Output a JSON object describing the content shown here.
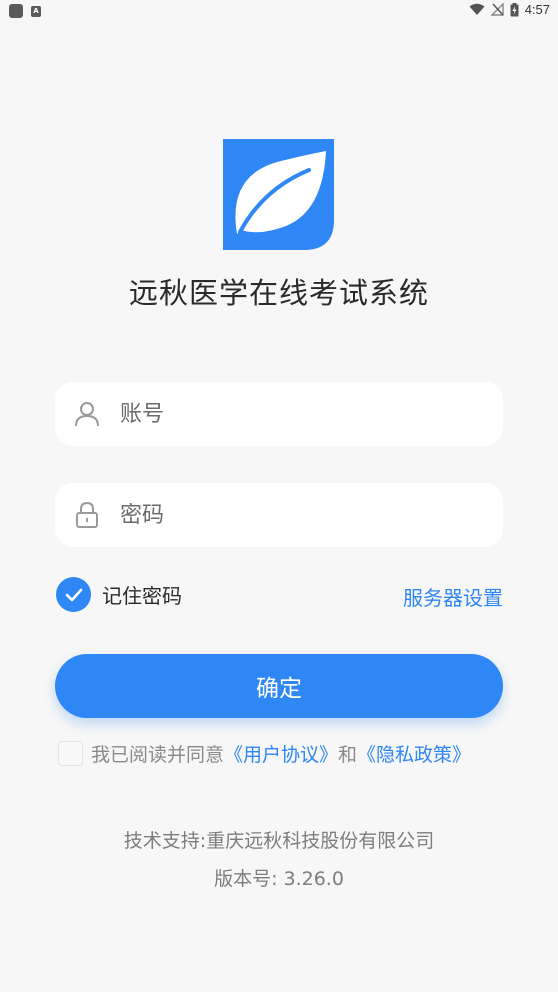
{
  "status_bar": {
    "time": "4:57",
    "icons": [
      "app-square-icon",
      "a-badge-icon",
      "wifi-icon",
      "no-signal-icon",
      "battery-charging-icon"
    ]
  },
  "app": {
    "title": "远秋医学在线考试系统",
    "logo_icon": "leaf-icon"
  },
  "login": {
    "account_placeholder": "账号",
    "account_value": "",
    "password_placeholder": "密码",
    "password_value": "",
    "remember_label": "记住密码",
    "remember_checked": true,
    "server_settings_label": "服务器设置",
    "submit_label": "确定"
  },
  "agreement": {
    "prefix": "我已阅读并同意",
    "user_agreement": "《用户协议》",
    "conjunction": "和",
    "privacy_policy": "《隐私政策》",
    "checked": false
  },
  "footer": {
    "support": "技术支持:重庆远秋科技股份有限公司",
    "version": "版本号: 3.26.0"
  },
  "colors": {
    "accent": "#2f86f5",
    "background": "#f7f7f7",
    "card": "#ffffff"
  }
}
